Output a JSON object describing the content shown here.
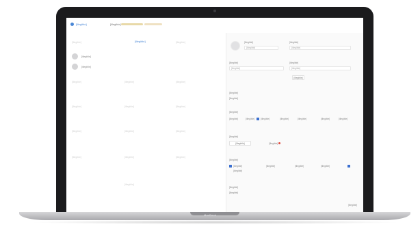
{
  "device": {
    "brand": "MacBook"
  },
  "colors": {
    "accent": "#4a87d6",
    "checkbox": "#3a6fd0",
    "alert": "#e0463a",
    "tag": "#e8d9a8"
  },
  "header": {
    "logo_icon": "app-logo-icon",
    "logo_text": "[illegible]",
    "tab_label": "[illegible]"
  },
  "left_panel": {
    "title": "[illegible]",
    "ghost_cells": [
      "[illegible]",
      "[illegible]",
      "[illegible]",
      "[illegible]",
      "[illegible]",
      "[illegible]",
      "[illegible]",
      "[illegible]",
      "[illegible]",
      "[illegible]",
      "[illegible]",
      "[illegible]",
      "[illegible]",
      "[illegible]",
      "[illegible]"
    ],
    "rows": [
      {
        "text": "[illegible]"
      },
      {
        "text": "[illegible]"
      }
    ]
  },
  "right_panel": {
    "profile_avatar_icon": "avatar-icon",
    "name_field": "[illegible]",
    "id_field": "[illegible]",
    "field_label_a": "[illegible]",
    "field_label_b": "[illegible]",
    "field_label_c": "[illegible]",
    "field_label_d": "[illegible]",
    "select_a": "[illegible]",
    "select_b": "[illegible]",
    "small_button": "[illegible]",
    "section_1": "[illegible]",
    "section_1_value": "[illegible]",
    "section_2": "[illegible]",
    "option_chips": [
      "[illegible]",
      "[illegible]",
      "[illegible]",
      "[illegible]",
      "[illegible]",
      "[illegible]",
      "[illegible]"
    ],
    "section_3": "[illegible]",
    "section_3_button": "[illegible]",
    "section_3_flag": "[illegible]",
    "section_4": "[illegible]",
    "check_items": [
      "[illegible]",
      "[illegible]",
      "[illegible]",
      "[illegible]",
      "[illegible]"
    ],
    "section_5": "[illegible]",
    "section_5_value": "[illegible]",
    "footer": "[illegible]"
  }
}
